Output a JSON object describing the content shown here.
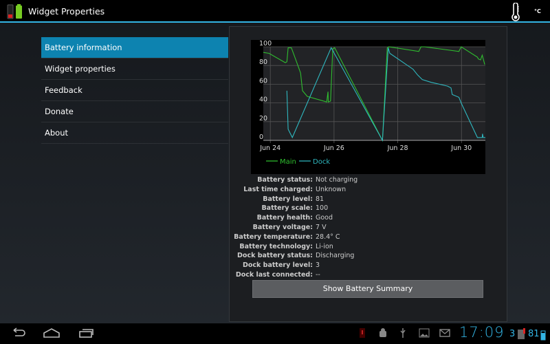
{
  "app": {
    "title": "Widget Properties",
    "temp_unit": "°C"
  },
  "menu": [
    {
      "label": "Battery information",
      "selected": true
    },
    {
      "label": "Widget properties"
    },
    {
      "label": "Feedback"
    },
    {
      "label": "Donate"
    },
    {
      "label": "About"
    }
  ],
  "chart_data": {
    "type": "line",
    "title": "",
    "xlabel": "",
    "ylabel": "",
    "ylim": [
      0,
      100
    ],
    "yticks": [
      "0",
      "20",
      "40",
      "60",
      "80",
      "100"
    ],
    "xlim": [
      -0.22,
      6.75
    ],
    "xticks": [
      {
        "day": 0,
        "label": "Jun 24"
      },
      {
        "day": 2,
        "label": "Jun 26"
      },
      {
        "day": 4,
        "label": "Jun 28"
      },
      {
        "day": 6,
        "label": "Jun 30"
      }
    ],
    "x_unit": "days since Jun 24",
    "grid": true,
    "legend": "bottom-left",
    "series": [
      {
        "name": "Main",
        "color": "#2fbf2f",
        "points": [
          [
            -0.22,
            94
          ],
          [
            -0.04,
            93
          ],
          [
            0.47,
            83
          ],
          [
            0.52,
            84
          ],
          [
            0.56,
            99
          ],
          [
            0.66,
            99
          ],
          [
            0.79,
            87
          ],
          [
            0.95,
            72
          ],
          [
            1.01,
            53
          ],
          [
            1.16,
            47
          ],
          [
            1.77,
            41
          ],
          [
            1.81,
            52
          ],
          [
            1.82,
            41
          ],
          [
            1.89,
            42
          ],
          [
            1.96,
            98
          ],
          [
            2.02,
            99
          ],
          [
            3.52,
            0
          ],
          [
            3.67,
            99
          ],
          [
            3.72,
            100
          ],
          [
            4.66,
            95
          ],
          [
            4.73,
            100
          ],
          [
            4.84,
            100
          ],
          [
            5.92,
            95
          ],
          [
            5.99,
            100
          ],
          [
            6.5,
            89
          ],
          [
            6.53,
            87
          ],
          [
            6.6,
            86
          ],
          [
            6.65,
            91
          ],
          [
            6.73,
            81
          ]
        ]
      },
      {
        "name": "Dock",
        "color": "#2fb8c0",
        "points": [
          [
            0.52,
            53
          ],
          [
            0.56,
            12
          ],
          [
            0.69,
            3
          ],
          [
            1.91,
            99
          ],
          [
            3.52,
            0
          ],
          [
            3.7,
            99
          ],
          [
            3.75,
            93
          ],
          [
            4.48,
            76
          ],
          [
            4.62,
            70
          ],
          [
            4.77,
            65
          ],
          [
            5.05,
            62
          ],
          [
            5.56,
            58
          ],
          [
            5.67,
            56
          ],
          [
            5.71,
            49
          ],
          [
            5.92,
            46
          ],
          [
            5.99,
            40
          ],
          [
            6.5,
            3
          ],
          [
            6.65,
            3
          ],
          [
            6.66,
            7
          ],
          [
            6.68,
            3
          ],
          [
            6.75,
            3
          ]
        ]
      }
    ]
  },
  "info": [
    {
      "label": "Battery status:",
      "value": "Not charging"
    },
    {
      "label": "Last time charged:",
      "value": "Unknown"
    },
    {
      "label": "Battery level:",
      "value": "81"
    },
    {
      "label": "Battery scale:",
      "value": "100"
    },
    {
      "label": "Battery health:",
      "value": "Good"
    },
    {
      "label": "Battery voltage:",
      "value": "7 V"
    },
    {
      "label": "Battery temperature:",
      "value": "28.4° C"
    },
    {
      "label": "Battery technology:",
      "value": "Li-ion"
    },
    {
      "label": "Dock battery status:",
      "value": "Discharging"
    },
    {
      "label": "Dock battery level:",
      "value": "3"
    },
    {
      "label": "Dock last connected:",
      "value": "--"
    }
  ],
  "summary_button": "Show Battery Summary",
  "status": {
    "time": "17:09",
    "dock_level": "3",
    "battery_level": "81"
  },
  "colors": {
    "accent": "#33b5e5",
    "selected": "#0d83b0"
  }
}
